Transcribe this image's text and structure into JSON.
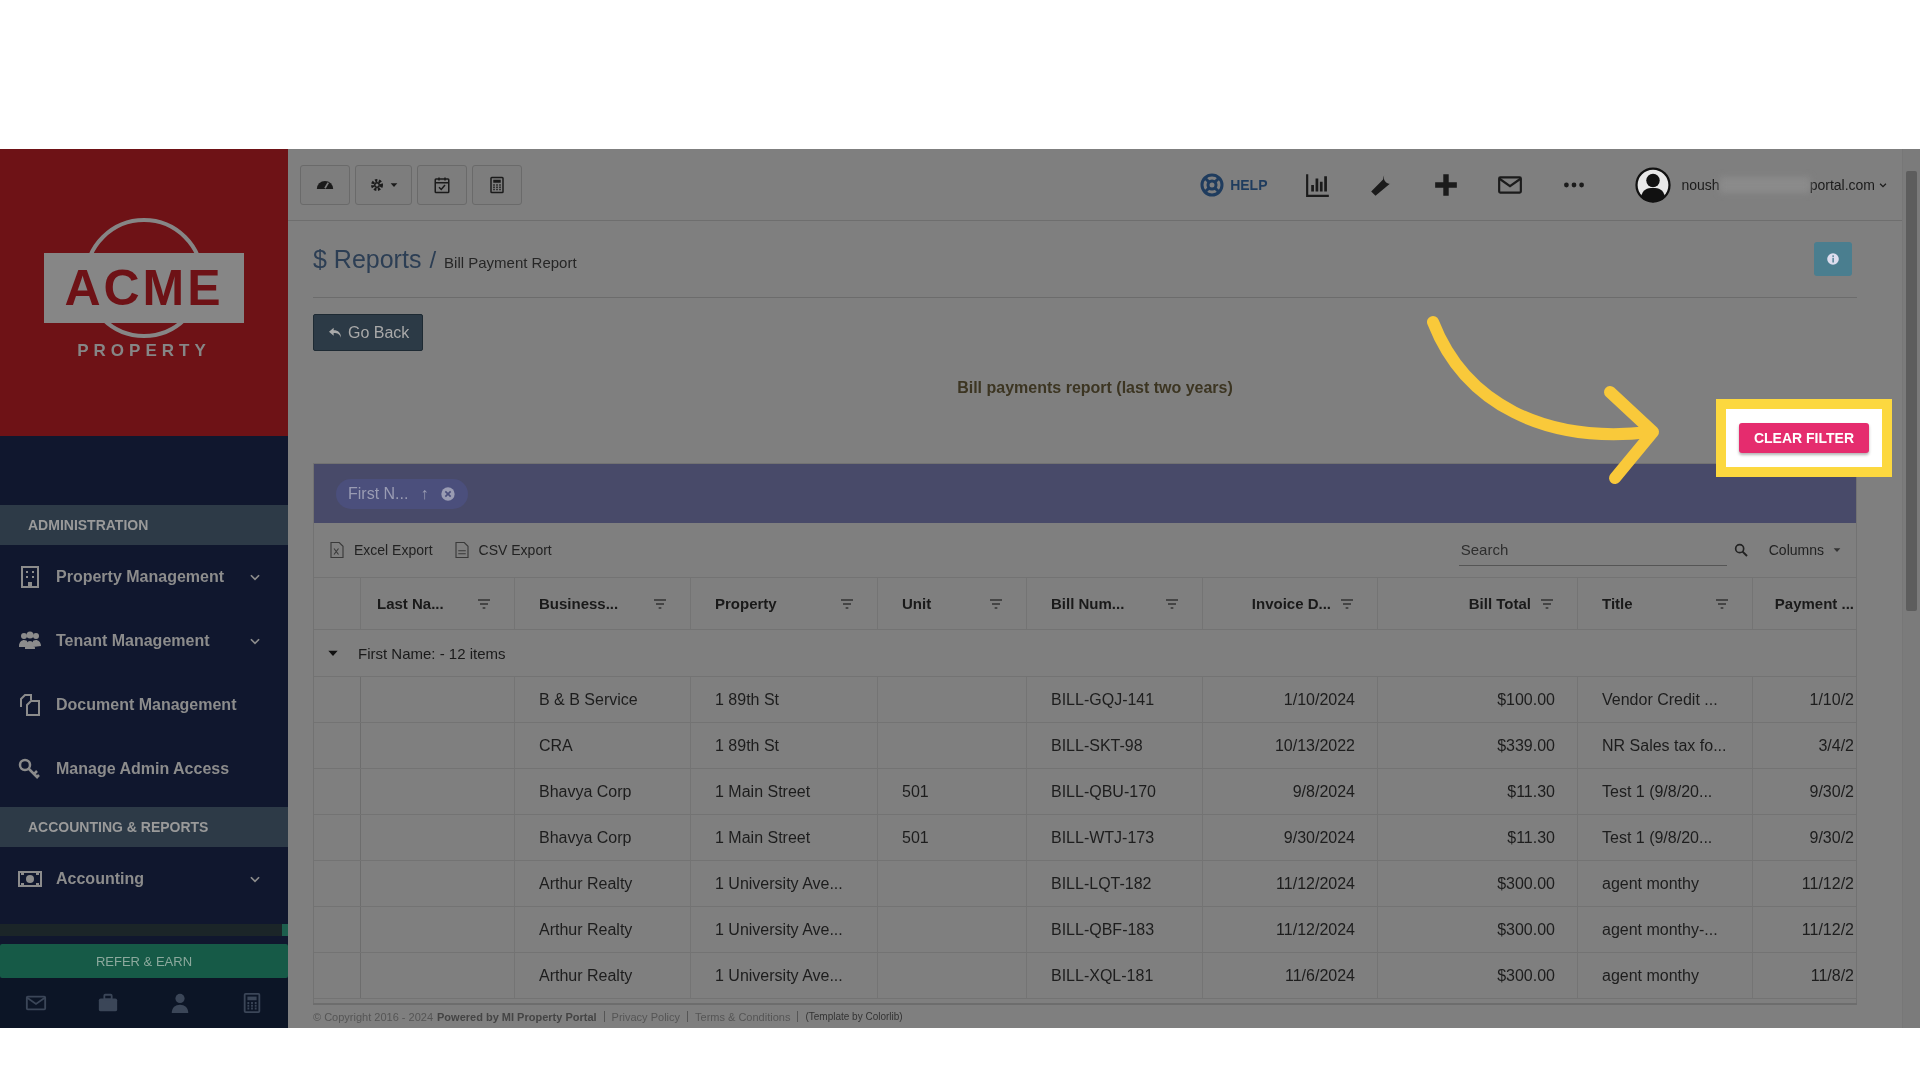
{
  "sidebar": {
    "logo": {
      "word": "ACME",
      "subtitle": "PROPERTY"
    },
    "sections": [
      {
        "title": "ADMINISTRATION",
        "items": [
          {
            "label": "Property Management",
            "expandable": true
          },
          {
            "label": "Tenant Management",
            "expandable": true
          },
          {
            "label": "Document Management",
            "expandable": false
          },
          {
            "label": "Manage Admin Access",
            "expandable": false
          }
        ]
      },
      {
        "title": "ACCOUNTING & REPORTS",
        "items": [
          {
            "label": "Accounting",
            "expandable": true
          }
        ]
      }
    ],
    "refer_button": "REFER & EARN"
  },
  "toolbar": {
    "help": "HELP",
    "user": {
      "email_start": "noush",
      "email_end": "portal.com"
    }
  },
  "breadcrumb": {
    "section": "$ Reports",
    "separator": "/",
    "page": "Bill Payment Report"
  },
  "go_back": "Go Back",
  "report_title": "Bill payments report (last two years)",
  "clear_filter": "CLEAR FILTER",
  "group_chip": {
    "label": "First N...",
    "arrow": "↑"
  },
  "export_buttons": [
    "Excel Export",
    "CSV Export"
  ],
  "search": {
    "placeholder": "Search"
  },
  "columns_button": "Columns",
  "table": {
    "columns": [
      "Last Na...",
      "Business...",
      "Property",
      "Unit",
      "Bill Num...",
      "Invoice D...",
      "Bill Total",
      "Title",
      "Payment ..."
    ],
    "group": {
      "label": "First Name: - 12 items",
      "expanded": true
    },
    "rows": [
      [
        "",
        "B & B Service",
        "1 89th St",
        "",
        "BILL-GQJ-141",
        "1/10/2024",
        "$100.00",
        "Vendor Credit ...",
        "1/10/2"
      ],
      [
        "",
        "CRA",
        "1 89th St",
        "",
        "BILL-SKT-98",
        "10/13/2022",
        "$339.00",
        "NR Sales tax fo...",
        "3/4/2"
      ],
      [
        "",
        "Bhavya Corp",
        "1 Main Street",
        "501",
        "BILL-QBU-170",
        "9/8/2024",
        "$11.30",
        "Test 1 (9/8/20...",
        "9/30/2"
      ],
      [
        "",
        "Bhavya Corp",
        "1 Main Street",
        "501",
        "BILL-WTJ-173",
        "9/30/2024",
        "$11.30",
        "Test 1 (9/8/20...",
        "9/30/2"
      ],
      [
        "",
        "Arthur Realty",
        "1 University Ave...",
        "",
        "BILL-LQT-182",
        "11/12/2024",
        "$300.00",
        "agent monthy",
        "11/12/2"
      ],
      [
        "",
        "Arthur Realty",
        "1 University Ave...",
        "",
        "BILL-QBF-183",
        "11/12/2024",
        "$300.00",
        "agent monthy-...",
        "11/12/2"
      ],
      [
        "",
        "Arthur Realty",
        "1 University Ave...",
        "",
        "BILL-XQL-181",
        "11/6/2024",
        "$300.00",
        "agent monthy",
        "11/8/2"
      ]
    ]
  },
  "footer": {
    "copyright": "© Copyright 2016 - 2024",
    "powered": "Powered by MI Property Portal",
    "links": [
      "Privacy Policy",
      "Terms & Conditions"
    ],
    "template": "(Template by Colorlib)"
  }
}
